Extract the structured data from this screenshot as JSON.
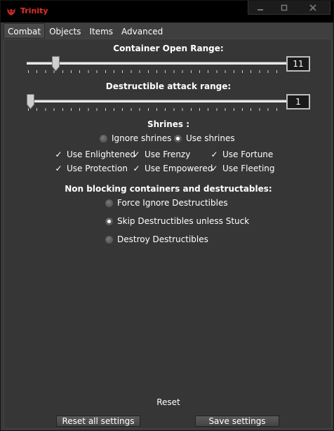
{
  "window": {
    "title": "Trinity",
    "controls": [
      "minimize-icon",
      "maximize-icon",
      "close-icon"
    ]
  },
  "menu": {
    "items": [
      {
        "label": "Combat",
        "active": true
      },
      {
        "label": "Objects",
        "active": false
      },
      {
        "label": "Items",
        "active": false
      },
      {
        "label": "Advanced",
        "active": false
      }
    ]
  },
  "container_range": {
    "label": "Container Open Range:",
    "value": "11",
    "fraction": 0.1
  },
  "destructible_range": {
    "label": "Destructible attack range:",
    "value": "1",
    "fraction": 0.0
  },
  "shrines": {
    "heading": "Shrines :",
    "mode_options": [
      {
        "label": "Ignore shrines",
        "selected": false
      },
      {
        "label": "Use shrines",
        "selected": true
      }
    ],
    "checks": [
      {
        "label": "Use Enlightened",
        "checked": true
      },
      {
        "label": "Use Frenzy",
        "checked": true
      },
      {
        "label": "Use Fortune",
        "checked": true
      },
      {
        "label": "Use Protection",
        "checked": true
      },
      {
        "label": "Use Empowered",
        "checked": true
      },
      {
        "label": "Use Fleeting",
        "checked": true
      }
    ]
  },
  "non_blocking": {
    "heading": "Non blocking containers and destructables:",
    "options": [
      {
        "label": "Force Ignore Destructibles",
        "selected": false
      },
      {
        "label": "Skip Destructibles unless Stuck",
        "selected": true
      },
      {
        "label": "Destroy Destructibles",
        "selected": false
      }
    ]
  },
  "footer": {
    "reset_label": "Reset",
    "reset_all_label": "Reset all settings",
    "save_label": "Save settings"
  },
  "colors": {
    "title": "#e23030",
    "background": "#363636"
  }
}
